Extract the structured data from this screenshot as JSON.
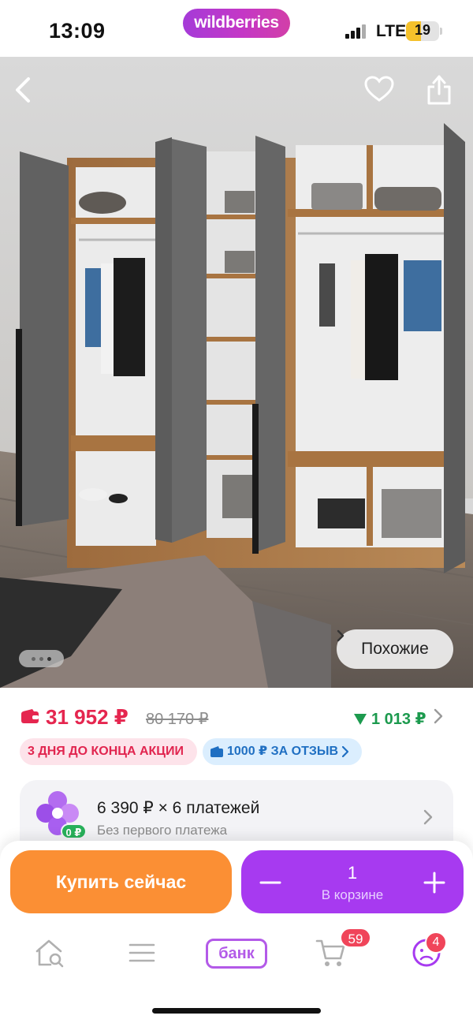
{
  "status_bar": {
    "time": "13:09",
    "brand": "wildberries",
    "network": "LTE",
    "battery": "19",
    "battery_level_percent": 19
  },
  "hero": {
    "back_icon": "chevron-left-icon",
    "favorite_icon": "heart-outline-icon",
    "share_icon": "share-icon",
    "similar_label": "Похожие",
    "gallery_dots_count": 3,
    "gallery_active_index": 2
  },
  "price": {
    "current": "31 952 ₽",
    "old": "80 170 ₽",
    "cashback": "1 013 ₽",
    "current_color": "#e5264f",
    "cashback_color": "#1c9a4e"
  },
  "badges": {
    "sale": "3 ДНЯ ДО КОНЦА АКЦИИ",
    "review": "1000 ₽ ЗА ОТЗЫВ"
  },
  "installment": {
    "title": "6 390 ₽ × 6 платежей",
    "subtitle": "Без первого платежа",
    "zero_badge": "0 ₽"
  },
  "actions": {
    "buy_now": "Купить сейчас",
    "cart_quantity": "1",
    "cart_label": "В корзине",
    "buy_color": "#fb8f34",
    "cart_color": "#a73af0"
  },
  "tab_bar": {
    "bank_label": "банк",
    "cart_badge": "59",
    "profile_badge": "4"
  }
}
